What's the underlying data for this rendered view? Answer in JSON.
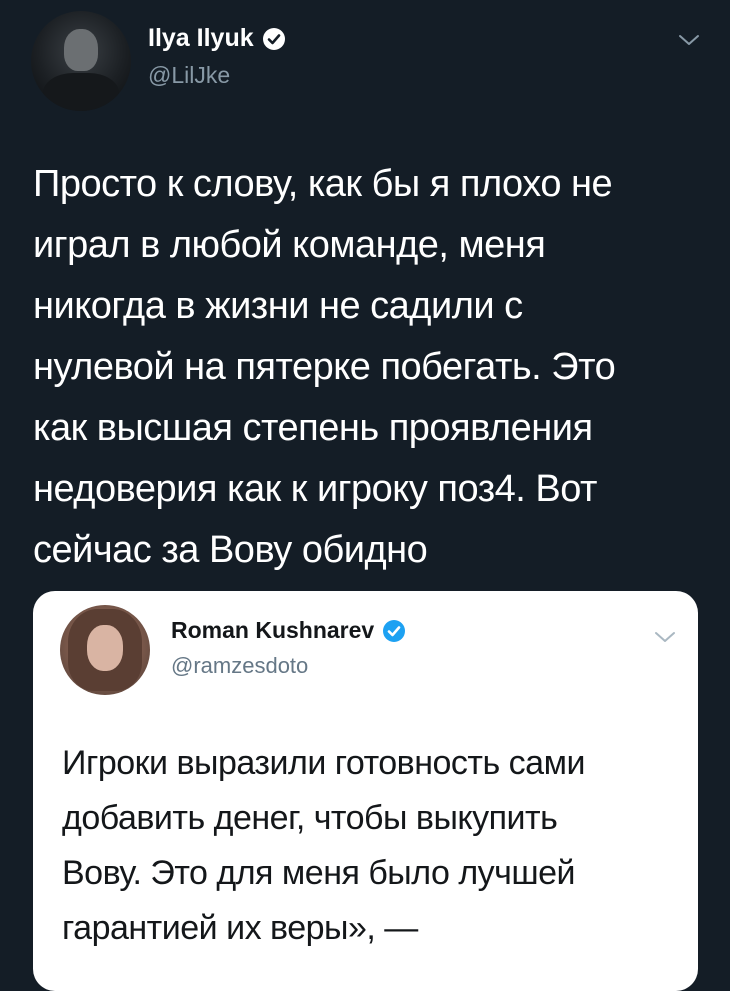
{
  "tweet": {
    "author": {
      "name": "Ilya Ilyuk",
      "handle": "@LilJke",
      "verified": true
    },
    "text_lines": [
      "Просто к слову, как бы я плохо не",
      "играл в любой команде, меня",
      "никогда в жизни не садили с",
      "нулевой на пятерке побегать. Это",
      "как высшая степень проявления",
      "недоверия как к игроку поз4. Вот",
      "сейчас за Вову обидно"
    ]
  },
  "quoted_tweet": {
    "author": {
      "name": "Roman Kushnarev",
      "handle": "@ramzesdoto",
      "verified": true
    },
    "text_lines": [
      "Игроки выразили готовность сами",
      "добавить денег, чтобы выкупить",
      "Вову. Это для меня было лучшей",
      "гарантией их веры», —"
    ]
  },
  "colors": {
    "background": "#141d26",
    "verified_blue": "#1da1f2",
    "secondary_text_dark": "#8899a6",
    "secondary_text_light": "#657786"
  },
  "icons": {
    "verified": "verified-badge-icon",
    "more": "chevron-down-icon"
  }
}
